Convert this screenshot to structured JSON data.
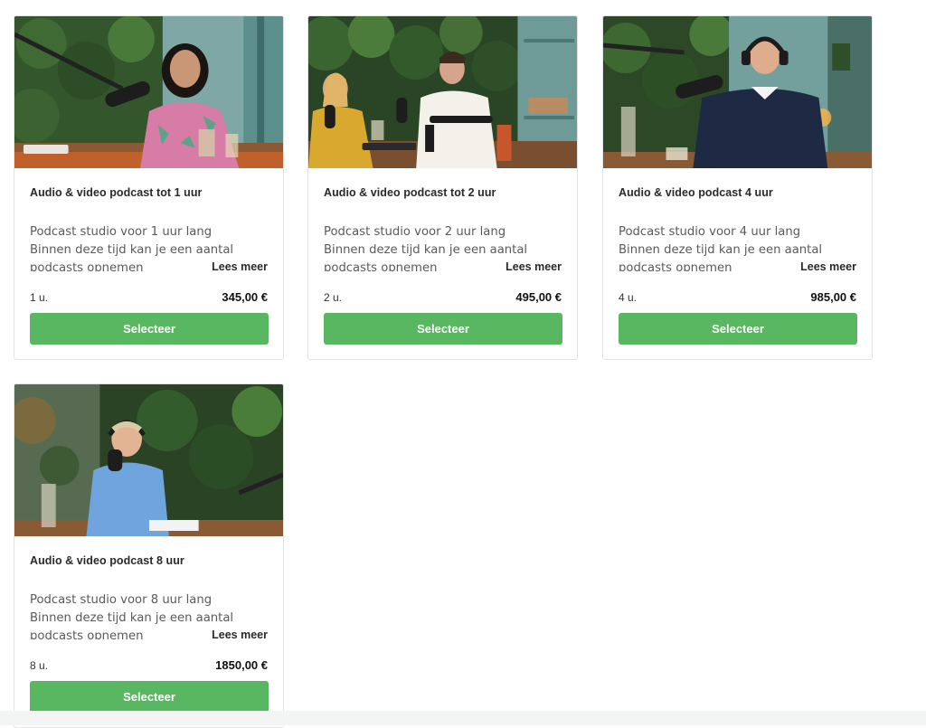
{
  "colors": {
    "accent": "#58b760",
    "background": "#ffffff",
    "card_border": "#e3e3e3"
  },
  "products": [
    {
      "title": "Audio & video podcast tot 1 uur",
      "desc_line_1": "Podcast studio voor 1 uur lang",
      "desc_line_2": "Binnen deze tijd kan je een aantal",
      "desc_line_3": "podcasts opnemen",
      "read_more": "Lees meer",
      "duration": "1 u.",
      "price": "345,00 €",
      "button": "Selecteer"
    },
    {
      "title": "Audio & video podcast tot 2 uur",
      "desc_line_1": "Podcast studio voor 2 uur lang",
      "desc_line_2": "Binnen deze tijd kan je een aantal",
      "desc_line_3": "podcasts opnemen",
      "read_more": "Lees meer",
      "duration": "2 u.",
      "price": "495,00 €",
      "button": "Selecteer"
    },
    {
      "title": "Audio & video podcast 4 uur",
      "desc_line_1": "Podcast studio voor 4 uur lang",
      "desc_line_2": "Binnen deze tijd kan je een aantal",
      "desc_line_3": "podcasts opnemen",
      "read_more": "Lees meer",
      "duration": "4 u.",
      "price": "985,00 €",
      "button": "Selecteer"
    },
    {
      "title": "Audio & video podcast 8 uur",
      "desc_line_1": "Podcast studio voor 8 uur lang",
      "desc_line_2": "Binnen deze tijd kan je een aantal",
      "desc_line_3": "podcasts opnemen",
      "read_more": "Lees meer",
      "duration": "8 u.",
      "price": "1850,00 €",
      "button": "Selecteer"
    }
  ]
}
